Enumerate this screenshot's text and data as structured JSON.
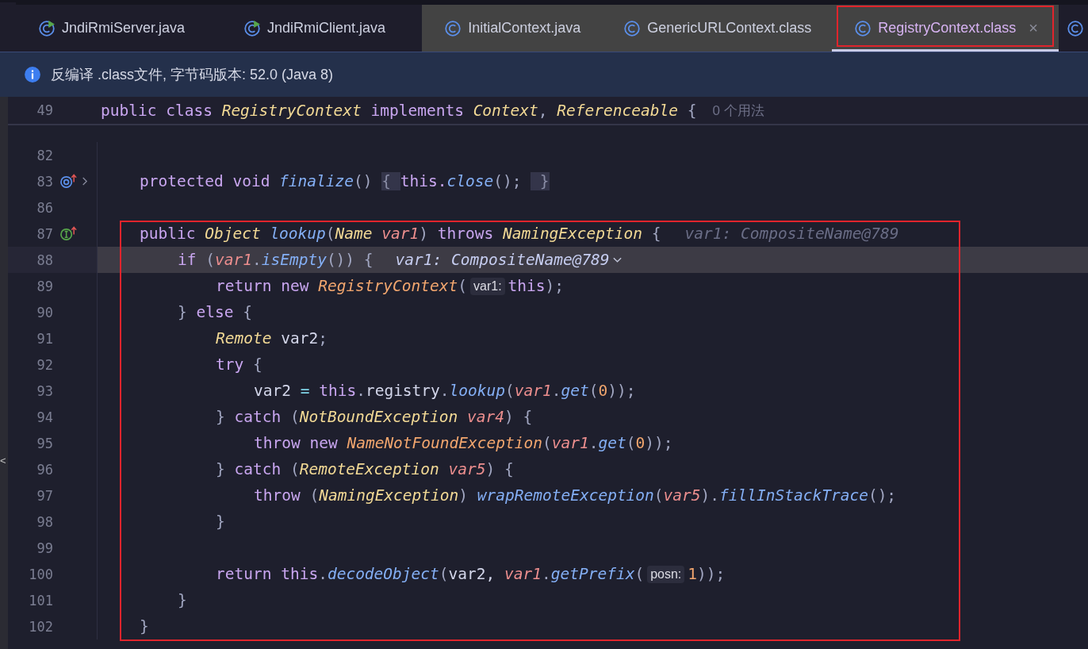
{
  "tabs": [
    {
      "label": "JndiRmiServer.java",
      "kind": "runnable",
      "selected": false,
      "annotated": false
    },
    {
      "label": "JndiRmiClient.java",
      "kind": "runnable",
      "selected": false,
      "annotated": false
    },
    {
      "label": "InitialContext.java",
      "kind": "class",
      "selected": false,
      "annotated": false
    },
    {
      "label": "GenericURLContext.class",
      "kind": "class",
      "selected": false,
      "annotated": false
    },
    {
      "label": "RegistryContext.class",
      "kind": "class",
      "selected": true,
      "annotated": true,
      "close": "×"
    },
    {
      "kind": "class",
      "selected": false,
      "annotated": false
    }
  ],
  "info_bar": {
    "text": "反编译 .class文件, 字节码版本: 52.0 (Java 8)"
  },
  "side_handle": "<",
  "sticky_line": {
    "number": "49",
    "tokens": [
      {
        "text": "public ",
        "kind": "kw"
      },
      {
        "text": "class ",
        "kind": "kw"
      },
      {
        "text": "RegistryContext ",
        "kind": "type"
      },
      {
        "text": "implements ",
        "kind": "kw"
      },
      {
        "text": "Context",
        "kind": "type"
      },
      {
        "text": ", ",
        "kind": "punct"
      },
      {
        "text": "Referenceable",
        "kind": "type"
      },
      {
        "text": " {",
        "kind": "punct"
      },
      {
        "text": "0 个用法",
        "kind": "usage"
      }
    ]
  },
  "blocks": [
    {
      "annotated": false,
      "lines": [
        {
          "number": "82",
          "current": false
        },
        {
          "number": "83",
          "current": false,
          "gutter": {
            "kind": "override"
          },
          "foldable": true,
          "tokens": [
            {
              "text": "protected ",
              "kind": "kw"
            },
            {
              "text": "void ",
              "kind": "kw"
            },
            {
              "text": "finalize",
              "kind": "fn"
            },
            {
              "text": "() ",
              "kind": "punct"
            },
            {
              "text": "{ ",
              "kind": "fold"
            },
            {
              "text": "this.",
              "kind": "kw"
            },
            {
              "text": "close",
              "kind": "fn"
            },
            {
              "text": "(); ",
              "kind": "punct"
            },
            {
              "text": " }",
              "kind": "fold"
            }
          ]
        },
        {
          "number": "86",
          "current": false
        }
      ]
    },
    {
      "annotated": true,
      "lines": [
        {
          "number": "87",
          "current": false,
          "gutter": {
            "kind": "implement"
          },
          "tokens": [
            {
              "text": "public ",
              "kind": "kw"
            },
            {
              "text": "Object ",
              "kind": "type"
            },
            {
              "text": "lookup",
              "kind": "fn"
            },
            {
              "text": "(",
              "kind": "punct"
            },
            {
              "text": "Name ",
              "kind": "type"
            },
            {
              "text": "var1",
              "kind": "var"
            },
            {
              "text": ") ",
              "kind": "punct"
            },
            {
              "text": "throws ",
              "kind": "kw"
            },
            {
              "text": "NamingException",
              "kind": "type"
            },
            {
              "text": " {",
              "kind": "punct"
            },
            {
              "text": "var1: CompositeName@789",
              "kind": "ghost"
            }
          ],
          "children": [
            {
              "number": "88",
              "current": true,
              "tokens": [
                {
                  "text": "if",
                  "kind": "kw"
                },
                {
                  "text": " (",
                  "kind": "punct"
                },
                {
                  "text": "var1",
                  "kind": "var"
                },
                {
                  "text": ".",
                  "kind": "punct"
                },
                {
                  "text": "isEmpty",
                  "kind": "fn"
                },
                {
                  "text": "()) {",
                  "kind": "punct"
                },
                {
                  "text": "var1: CompositeName@789",
                  "kind": "debug"
                }
              ],
              "children": [
                {
                  "number": "89",
                  "current": false,
                  "tokens": [
                    {
                      "text": "return ",
                      "kind": "kw"
                    },
                    {
                      "text": "new ",
                      "kind": "kw"
                    },
                    {
                      "text": "RegistryContext",
                      "kind": "ctor"
                    },
                    {
                      "text": "(",
                      "kind": "punct"
                    },
                    {
                      "text": "var1:",
                      "kind": "hint"
                    },
                    {
                      "text": "this",
                      "kind": "kw"
                    },
                    {
                      "text": ");",
                      "kind": "punct"
                    }
                  ]
                }
              ]
            },
            {
              "number": "90",
              "current": false,
              "tokens": [
                {
                  "text": "} ",
                  "kind": "punct"
                },
                {
                  "text": "else",
                  "kind": "kw"
                },
                {
                  "text": " {",
                  "kind": "punct"
                }
              ],
              "children": [
                {
                  "number": "91",
                  "current": false,
                  "tokens": [
                    {
                      "text": "Remote",
                      "kind": "type"
                    },
                    {
                      "text": " var2",
                      "kind": "plain"
                    },
                    {
                      "text": ";",
                      "kind": "punct"
                    }
                  ]
                },
                {
                  "number": "92",
                  "current": false,
                  "tokens": [
                    {
                      "text": "try",
                      "kind": "kw"
                    },
                    {
                      "text": " {",
                      "kind": "punct"
                    }
                  ],
                  "children": [
                    {
                      "number": "93",
                      "current": false,
                      "tokens": [
                        {
                          "text": "var2 ",
                          "kind": "plain"
                        },
                        {
                          "text": "= ",
                          "kind": "op"
                        },
                        {
                          "text": "this",
                          "kind": "kw"
                        },
                        {
                          "text": ".",
                          "kind": "punct"
                        },
                        {
                          "text": "registry",
                          "kind": "plain"
                        },
                        {
                          "text": ".",
                          "kind": "punct"
                        },
                        {
                          "text": "lookup",
                          "kind": "fn"
                        },
                        {
                          "text": "(",
                          "kind": "punct"
                        },
                        {
                          "text": "var1",
                          "kind": "var"
                        },
                        {
                          "text": ".",
                          "kind": "punct"
                        },
                        {
                          "text": "get",
                          "kind": "fn"
                        },
                        {
                          "text": "(",
                          "kind": "punct"
                        },
                        {
                          "text": "0",
                          "kind": "num"
                        },
                        {
                          "text": "));",
                          "kind": "punct"
                        }
                      ]
                    }
                  ]
                },
                {
                  "number": "94",
                  "current": false,
                  "tokens": [
                    {
                      "text": "} ",
                      "kind": "punct"
                    },
                    {
                      "text": "catch",
                      "kind": "kw"
                    },
                    {
                      "text": " (",
                      "kind": "punct"
                    },
                    {
                      "text": "NotBoundException ",
                      "kind": "type"
                    },
                    {
                      "text": "var4",
                      "kind": "var"
                    },
                    {
                      "text": ") {",
                      "kind": "punct"
                    }
                  ],
                  "children": [
                    {
                      "number": "95",
                      "current": false,
                      "tokens": [
                        {
                          "text": "throw ",
                          "kind": "kw"
                        },
                        {
                          "text": "new ",
                          "kind": "kw"
                        },
                        {
                          "text": "NameNotFoundException",
                          "kind": "ctor"
                        },
                        {
                          "text": "(",
                          "kind": "punct"
                        },
                        {
                          "text": "var1",
                          "kind": "var"
                        },
                        {
                          "text": ".",
                          "kind": "punct"
                        },
                        {
                          "text": "get",
                          "kind": "fn"
                        },
                        {
                          "text": "(",
                          "kind": "punct"
                        },
                        {
                          "text": "0",
                          "kind": "num"
                        },
                        {
                          "text": "));",
                          "kind": "punct"
                        }
                      ]
                    }
                  ]
                },
                {
                  "number": "96",
                  "current": false,
                  "tokens": [
                    {
                      "text": "} ",
                      "kind": "punct"
                    },
                    {
                      "text": "catch",
                      "kind": "kw"
                    },
                    {
                      "text": " (",
                      "kind": "punct"
                    },
                    {
                      "text": "RemoteException ",
                      "kind": "type"
                    },
                    {
                      "text": "var5",
                      "kind": "var"
                    },
                    {
                      "text": ") {",
                      "kind": "punct"
                    }
                  ],
                  "children": [
                    {
                      "number": "97",
                      "current": false,
                      "tokens": [
                        {
                          "text": "throw",
                          "kind": "kw"
                        },
                        {
                          "text": " (",
                          "kind": "punct"
                        },
                        {
                          "text": "NamingException",
                          "kind": "type"
                        },
                        {
                          "text": ") ",
                          "kind": "punct"
                        },
                        {
                          "text": "wrapRemoteException",
                          "kind": "fn"
                        },
                        {
                          "text": "(",
                          "kind": "punct"
                        },
                        {
                          "text": "var5",
                          "kind": "var"
                        },
                        {
                          "text": ").",
                          "kind": "punct"
                        },
                        {
                          "text": "fillInStackTrace",
                          "kind": "fn"
                        },
                        {
                          "text": "();",
                          "kind": "punct"
                        }
                      ]
                    }
                  ]
                },
                {
                  "number": "98",
                  "current": false,
                  "tokens": [
                    {
                      "text": "}",
                      "kind": "punct"
                    }
                  ]
                },
                {
                  "number": "99",
                  "current": false
                },
                {
                  "number": "100",
                  "current": false,
                  "tokens": [
                    {
                      "text": "return ",
                      "kind": "kw"
                    },
                    {
                      "text": "this",
                      "kind": "kw"
                    },
                    {
                      "text": ".",
                      "kind": "punct"
                    },
                    {
                      "text": "decodeObject",
                      "kind": "fn"
                    },
                    {
                      "text": "(",
                      "kind": "punct"
                    },
                    {
                      "text": "var2, ",
                      "kind": "plain"
                    },
                    {
                      "text": "var1",
                      "kind": "var"
                    },
                    {
                      "text": ".",
                      "kind": "punct"
                    },
                    {
                      "text": "getPrefix",
                      "kind": "fn"
                    },
                    {
                      "text": "(",
                      "kind": "punct"
                    },
                    {
                      "text": "posn:",
                      "kind": "hint"
                    },
                    {
                      "text": "1",
                      "kind": "num"
                    },
                    {
                      "text": "));",
                      "kind": "punct"
                    }
                  ]
                }
              ]
            },
            {
              "number": "101",
              "current": false,
              "tokens": [
                {
                  "text": "}",
                  "kind": "punct"
                }
              ]
            }
          ]
        },
        {
          "number": "102",
          "current": false,
          "tokens": [
            {
              "text": "}",
              "kind": "punct"
            }
          ]
        }
      ]
    }
  ]
}
